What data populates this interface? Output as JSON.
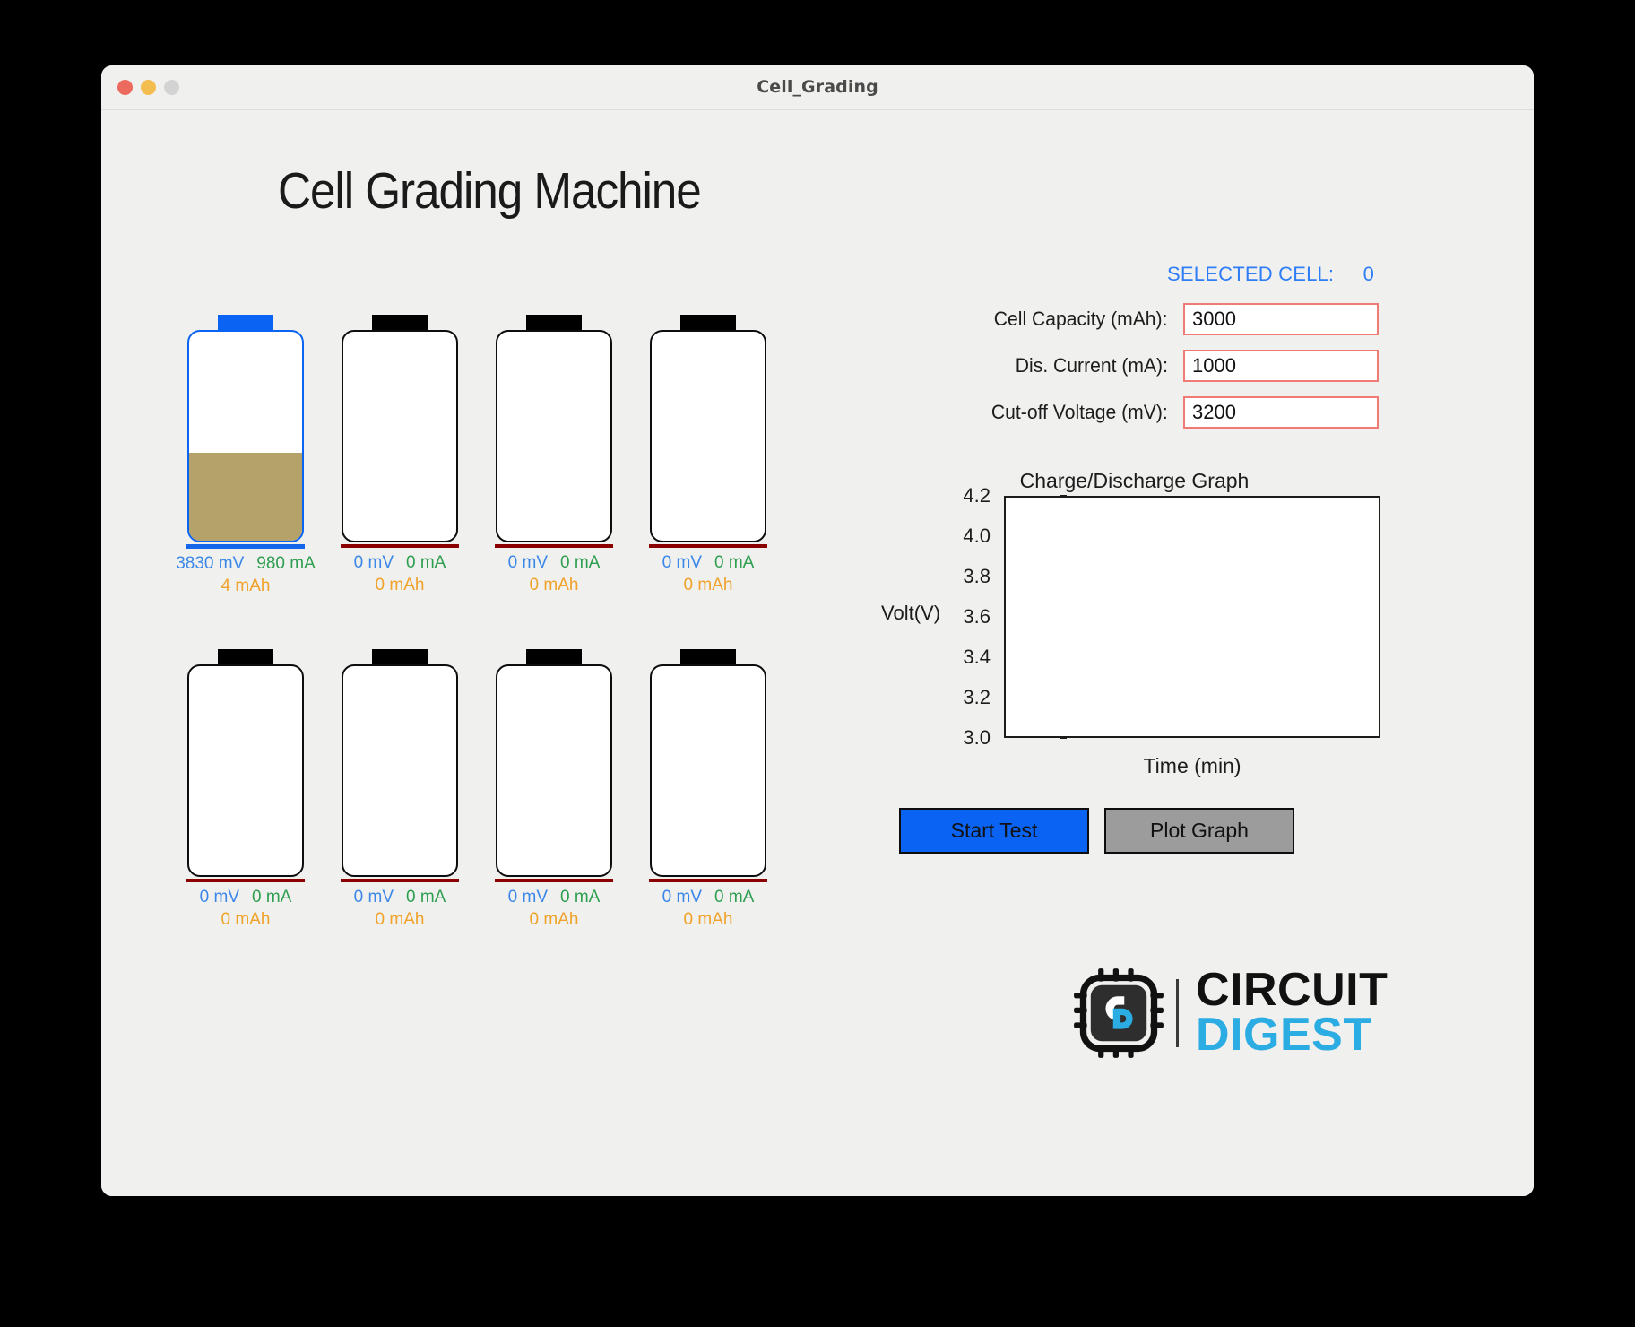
{
  "window": {
    "title": "Cell_Grading",
    "traffic_lights": [
      "close",
      "minimize",
      "zoom"
    ]
  },
  "app": {
    "heading": "Cell Grading Machine"
  },
  "selected_cell": {
    "label": "SELECTED CELL:",
    "value": "0"
  },
  "params": [
    {
      "label": "Cell Capacity (mAh):",
      "value": "3000",
      "placeholder": "3000"
    },
    {
      "label": "Dis. Current (mA):",
      "value": "1000",
      "placeholder": "1000"
    },
    {
      "label": "Cut-off Voltage (mV):",
      "value": "3200",
      "placeholder": "3200"
    }
  ],
  "cells": [
    {
      "index": "0",
      "mv": "3830 mV",
      "ma": "980 mA",
      "mah": "4 mAh",
      "selected": true,
      "fill_percent": 42
    },
    {
      "index": "1",
      "mv": "0 mV",
      "ma": "0 mA",
      "mah": "0 mAh",
      "selected": false,
      "fill_percent": 0
    },
    {
      "index": "2",
      "mv": "0 mV",
      "ma": "0 mA",
      "mah": "0 mAh",
      "selected": false,
      "fill_percent": 0
    },
    {
      "index": "3",
      "mv": "0 mV",
      "ma": "0 mA",
      "mah": "0 mAh",
      "selected": false,
      "fill_percent": 0
    },
    {
      "index": "4",
      "mv": "0 mV",
      "ma": "0 mA",
      "mah": "0 mAh",
      "selected": false,
      "fill_percent": 0
    },
    {
      "index": "5",
      "mv": "0 mV",
      "ma": "0 mA",
      "mah": "0 mAh",
      "selected": false,
      "fill_percent": 0
    },
    {
      "index": "6",
      "mv": "0 mV",
      "ma": "0 mA",
      "mah": "0 mAh",
      "selected": false,
      "fill_percent": 0
    },
    {
      "index": "7",
      "mv": "0 mV",
      "ma": "0 mA",
      "mah": "0 mAh",
      "selected": false,
      "fill_percent": 0
    }
  ],
  "buttons": {
    "start_test": "Start Test",
    "plot_graph": "Plot Graph"
  },
  "logo": {
    "icon": "circuit-chip-cd-icon",
    "line1": "CIRCUIT",
    "line2": "DIGEST"
  },
  "colors": {
    "accent_blue": "#0a63f2",
    "selected_blue": "#2f7ef5",
    "input_border_red": "#ef7b74",
    "cell_border_red": "#8b0000",
    "fill_tan": "#b5a16a",
    "mv_blue": "#3b87e8",
    "ma_green": "#2e9e4f",
    "mah_orange": "#f0a22a",
    "plot_button_gray": "#9c9c9c",
    "logo_cyan": "#2bace2",
    "window_bg": "#f0f0ef"
  },
  "chart_data": {
    "type": "line",
    "title": "Charge/Discharge Graph",
    "xlabel": "Time (min)",
    "ylabel": "Volt(V)",
    "ylim": [
      3.0,
      4.2
    ],
    "yticks": [
      "4.2",
      "4.0",
      "3.8",
      "3.6",
      "3.4",
      "3.2",
      "3.0"
    ],
    "xticks": [],
    "grid": false,
    "legend": null,
    "series": [],
    "x": [],
    "note": "empty plot area - no data series rendered"
  }
}
